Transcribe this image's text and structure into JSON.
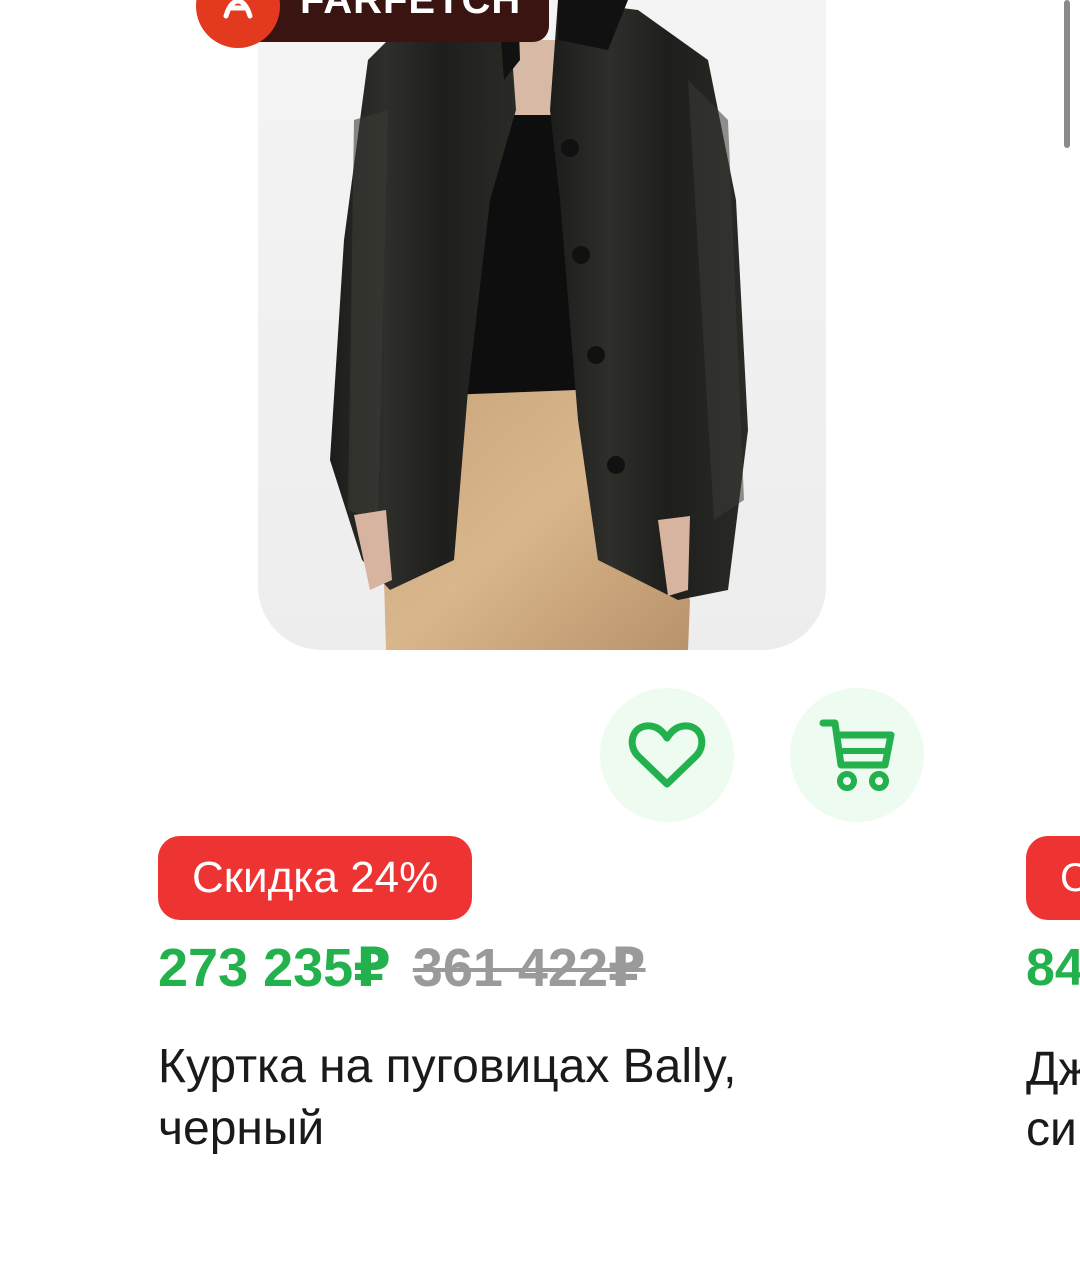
{
  "seller": {
    "name": "FARFETCH",
    "logo_icon": "farfetch-logo-icon",
    "logo_color": "#e2391f"
  },
  "product": {
    "image_description": "product-photo",
    "discount_label": "Скидка 24%",
    "price_current": "273 235₽",
    "price_old": "361 422₽",
    "title": "Куртка на пуговицах Bally, черный"
  },
  "actions": {
    "favorite_icon": "heart-icon",
    "cart_icon": "cart-icon"
  },
  "next_card": {
    "discount_label_partial": "С",
    "price_partial": "84",
    "title_line1_partial": "Дж",
    "title_line2_partial": "си"
  },
  "colors": {
    "accent_green": "#22b14c",
    "discount_red": "#ee3333",
    "button_bg": "#edfbf0",
    "old_price_gray": "#9a9a9a"
  }
}
